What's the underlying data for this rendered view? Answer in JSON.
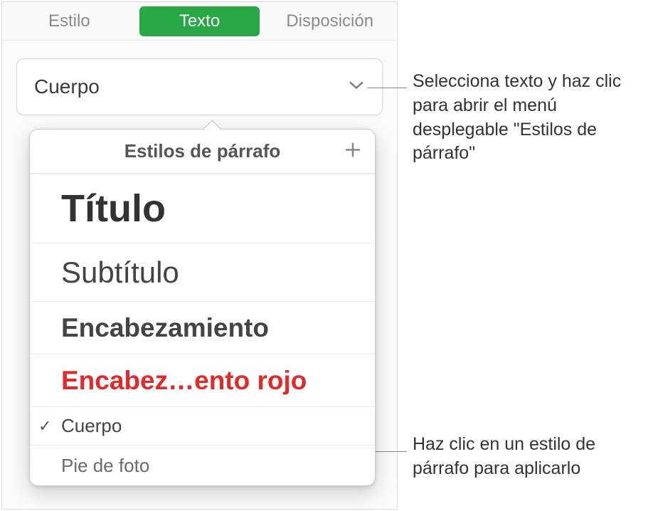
{
  "tabs": {
    "style": "Estilo",
    "text": "Texto",
    "layout": "Disposición"
  },
  "selector": {
    "current": "Cuerpo"
  },
  "popover": {
    "title": "Estilos de párrafo",
    "styles": {
      "titulo": "Título",
      "subtitulo": "Subtítulo",
      "encabezamiento": "Encabezamiento",
      "encabez_rojo": "Encabez…ento rojo",
      "cuerpo": "Cuerpo",
      "pie": "Pie de foto"
    },
    "checkmark": "✓"
  },
  "callouts": {
    "c1": "Selecciona texto y haz clic para abrir el menú desplegable \"Estilos de párrafo\"",
    "c2": "Haz clic en un estilo de párrafo para aplicarlo"
  }
}
